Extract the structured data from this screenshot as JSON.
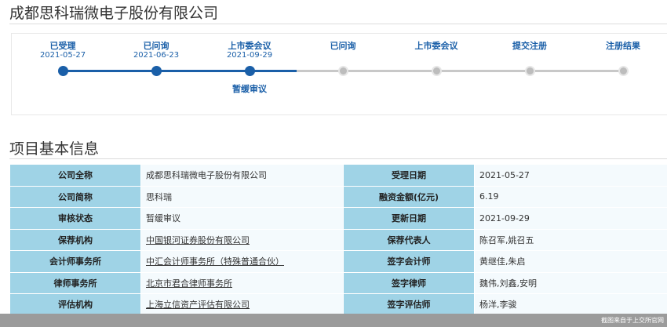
{
  "header": {
    "company_name": "成都思科瑞微电子股份有限公司"
  },
  "colors": {
    "accent": "#1a5fa8",
    "label_bg": "#9fd3e6",
    "value_bg": "#f4fafd",
    "pending": "#bdbdbd"
  },
  "progress": {
    "steps": [
      {
        "label": "已受理",
        "date": "2021-05-27",
        "status": "done"
      },
      {
        "label": "已问询",
        "date": "2021-06-23",
        "status": "done"
      },
      {
        "label": "上市委会议",
        "date": "2021-09-29",
        "status": "done"
      },
      {
        "label": "已问询",
        "date": "",
        "status": "pending"
      },
      {
        "label": "上市委会议",
        "date": "",
        "status": "pending"
      },
      {
        "label": "提交注册",
        "date": "",
        "status": "pending"
      },
      {
        "label": "注册结果",
        "date": "",
        "status": "pending"
      }
    ],
    "current_status": "暂缓审议"
  },
  "section": {
    "title": "项目基本信息"
  },
  "info_table": {
    "rows": [
      {
        "l1": "公司全称",
        "v1": "成都思科瑞微电子股份有限公司",
        "l2": "受理日期",
        "v2": "2021-05-27"
      },
      {
        "l1": "公司简称",
        "v1": "思科瑞",
        "l2": "融资金额(亿元)",
        "v2": "6.19"
      },
      {
        "l1": "审核状态",
        "v1": "暂缓审议",
        "l2": "更新日期",
        "v2": "2021-09-29"
      },
      {
        "l1": "保荐机构",
        "v1": "中国银河证券股份有限公司",
        "l2": "保荐代表人",
        "v2": "陈召军,姚召五"
      },
      {
        "l1": "会计师事务所",
        "v1": "中汇会计师事务所（特殊普通合伙）",
        "l2": "签字会计师",
        "v2": "黄继佳,朱启"
      },
      {
        "l1": "律师事务所",
        "v1": "北京市君合律师事务所",
        "l2": "签字律师",
        "v2": "魏伟,刘鑫,安明"
      },
      {
        "l1": "评估机构",
        "v1": "上海立信资产评估有限公司",
        "l2": "签字评估师",
        "v2": "杨洋,李骏"
      }
    ]
  },
  "footer": {
    "note": "截图来自于上交所官网"
  }
}
